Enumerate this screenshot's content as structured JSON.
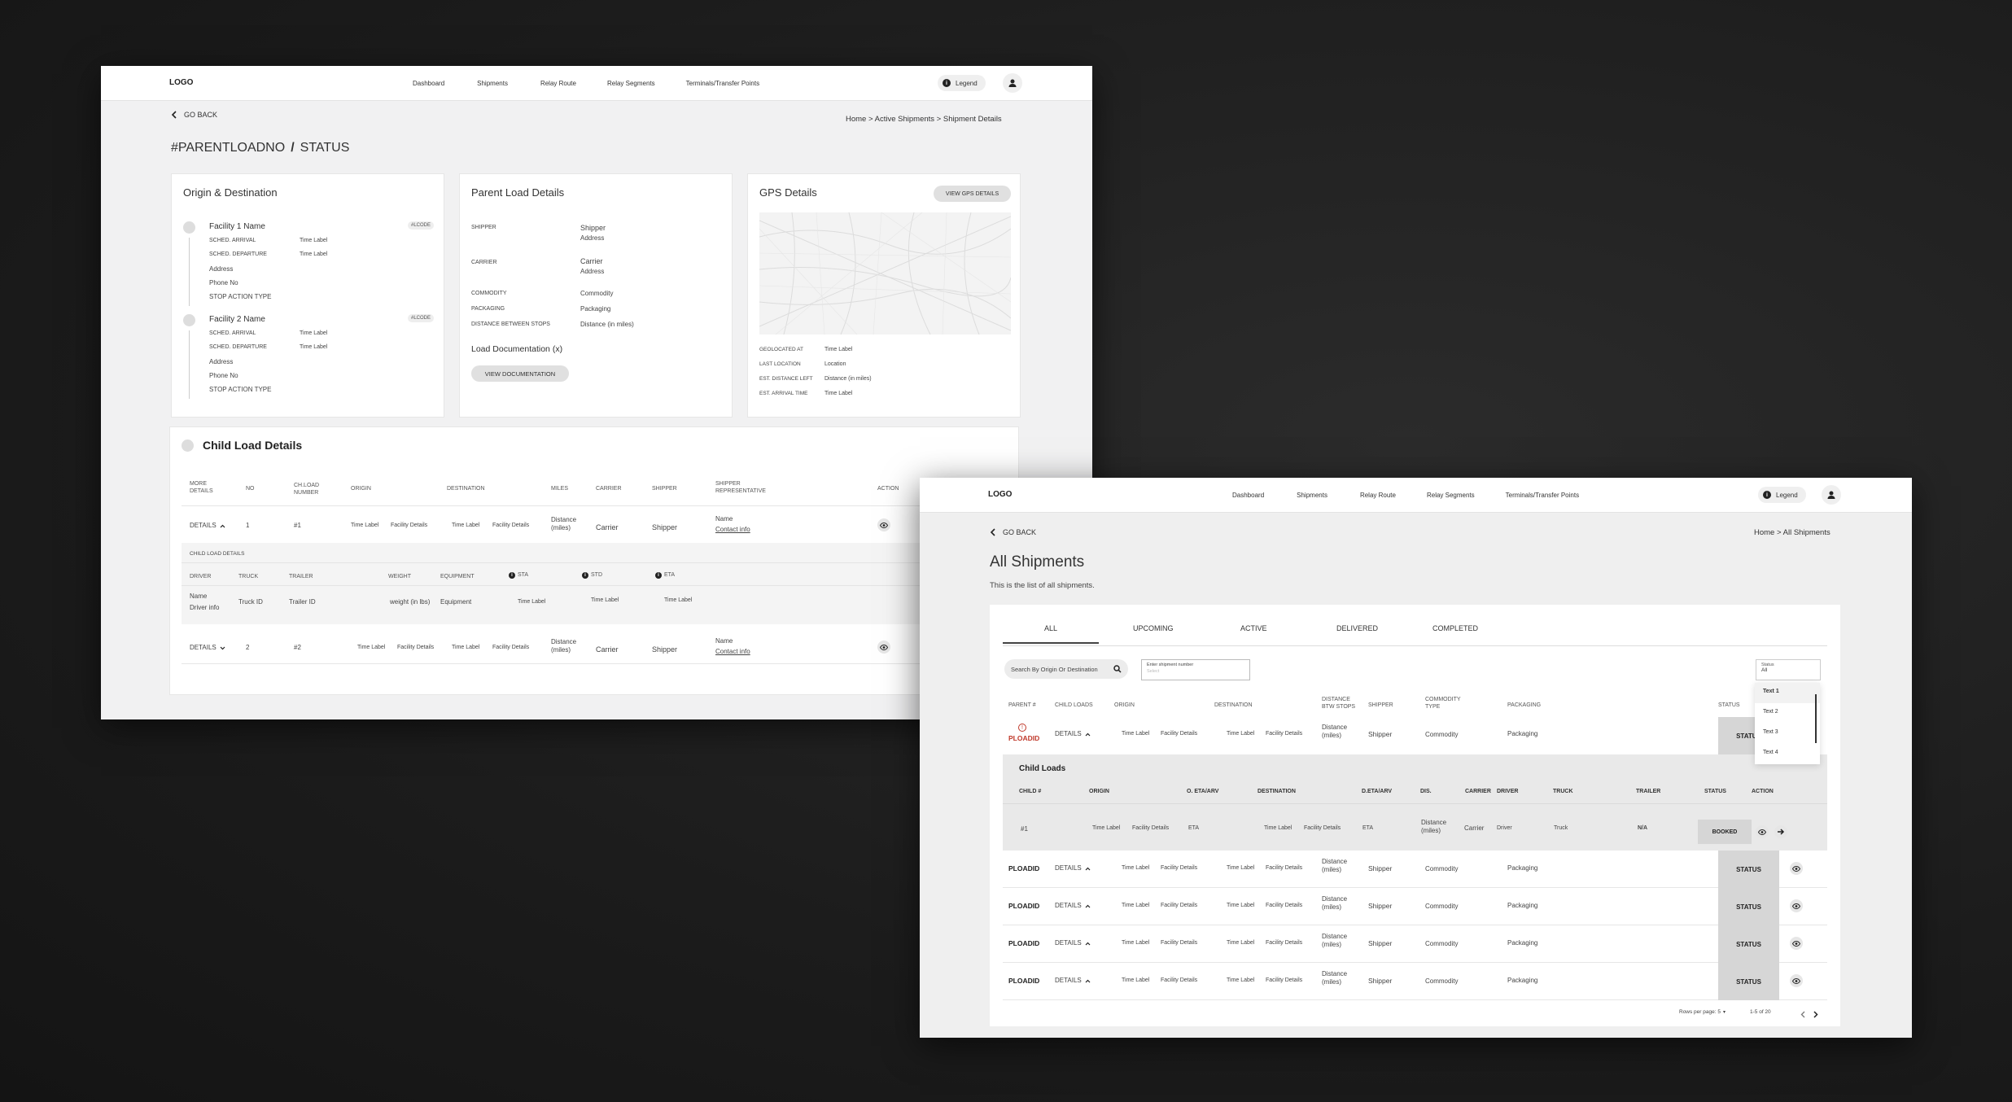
{
  "w1": {
    "logo": "LOGO",
    "nav": [
      "Dashboard",
      "Shipments",
      "Relay Route",
      "Relay Segments",
      "Terminals/Transfer Points"
    ],
    "legend": "Legend",
    "go_back": "GO BACK",
    "breadcrumb": "Home > Active Shipments > Shipment Details",
    "title_id": "#PARENTLOADNO",
    "title_sep": "/",
    "title_status": "STATUS",
    "origin": {
      "title": "Origin & Destination",
      "stops": [
        {
          "name": "Facility 1 Name",
          "code": "#LCODE",
          "arrival_label": "SCHED. ARRIVAL",
          "arrival": "Time Label",
          "departure_label": "SCHED. DEPARTURE",
          "departure": "Time Label",
          "address": "Address",
          "phone": "Phone No",
          "action": "STOP ACTION TYPE"
        },
        {
          "name": "Facility 2 Name",
          "code": "#LCODE",
          "arrival_label": "SCHED. ARRIVAL",
          "arrival": "Time Label",
          "departure_label": "SCHED. DEPARTURE",
          "departure": "Time Label",
          "address": "Address",
          "phone": "Phone No",
          "action": "STOP ACTION TYPE"
        }
      ]
    },
    "parent": {
      "title": "Parent Load Details",
      "shipper_label": "SHIPPER",
      "shipper": "Shipper",
      "shipper_addr": "Address",
      "carrier_label": "CARRIER",
      "carrier": "Carrier",
      "carrier_addr": "Address",
      "commodity_label": "COMMODITY",
      "commodity": "Commodity",
      "packaging_label": "PACKAGING",
      "packaging": "Packaging",
      "distance_label": "DISTANCE BETWEEN STOPS",
      "distance": "Distance (in miles)",
      "doc_title": "Load Documentation (x)",
      "doc_button": "VIEW DOCUMENTATION"
    },
    "gps": {
      "title": "GPS Details",
      "button": "VIEW GPS DETAILS",
      "rows": [
        [
          "GEOLOCATED AT",
          "Time Label"
        ],
        [
          "LAST LOCATION",
          "Location"
        ],
        [
          "EST. DISTANCE LEFT",
          "Distance (in miles)"
        ],
        [
          "EST. ARRIVAL TIME",
          "Time Label"
        ]
      ]
    },
    "child": {
      "title": "Child Load Details",
      "headers": [
        "MORE DETAILS",
        "NO",
        "CH.LOAD NUMBER",
        "ORIGIN",
        "DESTINATION",
        "MILES",
        "CARRIER",
        "SHIPPER",
        "SHIPPER REPRESENTATIVE",
        "ACTION"
      ],
      "rows": [
        {
          "details": "DETAILS",
          "no": "1",
          "num": "#1",
          "o_time": "Time Label",
          "o_fac": "Facility Details",
          "d_time": "Time Label",
          "d_fac": "Facility Details",
          "miles": "Distance (miles)",
          "carrier": "Carrier",
          "shipper": "Shipper",
          "rep": "Name",
          "rep_link": "Contact info"
        },
        {
          "details": "DETAILS",
          "no": "2",
          "num": "#2",
          "o_time": "Time Label",
          "o_fac": "Facility Details",
          "d_time": "Time Label",
          "d_fac": "Facility Details",
          "miles": "Distance (miles)",
          "carrier": "Carrier",
          "shipper": "Shipper",
          "rep": "Name",
          "rep_link": "Contact info"
        }
      ],
      "sub_title": "CHILD LOAD DETAILS",
      "sub_headers": [
        "DRIVER",
        "TRUCK",
        "TRAILER",
        "WEIGHT",
        "EQUIPMENT",
        "STA",
        "STD",
        "ETA"
      ],
      "sub_row": {
        "driver": "Name",
        "driver_info": "Driver info",
        "truck": "Truck ID",
        "trailer": "Trailer ID",
        "weight": "weight (in lbs)",
        "equipment": "Equipment",
        "sta": "Time Label",
        "std": "Time Label",
        "eta": "Time Label"
      }
    }
  },
  "w2": {
    "logo": "LOGO",
    "nav": [
      "Dashboard",
      "Shipments",
      "Relay Route",
      "Relay Segments",
      "Terminals/Transfer Points"
    ],
    "legend": "Legend",
    "go_back": "GO BACK",
    "breadcrumb": "Home > All Shipments",
    "title": "All Shipments",
    "subtitle": "This is the list of all shipments.",
    "tabs": [
      "ALL",
      "UPCOMING",
      "ACTIVE",
      "DELIVERED",
      "COMPLETED"
    ],
    "search_placeholder": "Search By Origin Or Destination",
    "shipment_label": "Enter shipment number",
    "shipment_placeholder": "Select",
    "status_select": {
      "label": "Status",
      "value": "All",
      "options": [
        "Text 1",
        "Text 2",
        "Text 3",
        "Text 4"
      ]
    },
    "headers": [
      "PARENT #",
      "CHILD LOADS",
      "ORIGIN",
      "DESTINATION",
      "DISTANCE BTW STOPS",
      "SHIPPER",
      "COMMODITY TYPE",
      "PACKAGING",
      "STATUS"
    ],
    "first_row": {
      "id": "PLOADID",
      "details": "DETAILS",
      "o_time": "Time Label",
      "o_fac": "Facility Details",
      "d_time": "Time Label",
      "d_fac": "Facility Details",
      "distance": "Distance (miles)",
      "shipper": "Shipper",
      "commodity": "Commodity",
      "packaging": "Packaging",
      "status": "STATUS"
    },
    "child": {
      "title": "Child Loads",
      "headers": [
        "CHILD #",
        "ORIGIN",
        "O. ETA/ARV",
        "DESTINATION",
        "D.ETA/ARV",
        "DIS.",
        "CARRIER",
        "DRIVER",
        "TRUCK",
        "TRAILER",
        "STATUS",
        "ACTION"
      ],
      "row": {
        "id": "#1",
        "o_time": "Time Label",
        "o_fac": "Facility Details",
        "o_eta": "ETA",
        "d_time": "Time Label",
        "d_fac": "Facility Details",
        "d_eta": "ETA",
        "dis": "Distance (miles)",
        "carrier": "Carrier",
        "driver": "Driver",
        "truck": "Truck",
        "trailer": "N/A",
        "status": "BOOKED"
      }
    },
    "rows": [
      {
        "id": "PLOADID",
        "details": "DETAILS",
        "o_time": "Time Label",
        "o_fac": "Facility Details",
        "d_time": "Time Label",
        "d_fac": "Facility Details",
        "distance": "Distance (miles)",
        "shipper": "Shipper",
        "commodity": "Commodity",
        "packaging": "Packaging",
        "status": "STATUS"
      },
      {
        "id": "PLOADID",
        "details": "DETAILS",
        "o_time": "Time Label",
        "o_fac": "Facility Details",
        "d_time": "Time Label",
        "d_fac": "Facility Details",
        "distance": "Distance (miles)",
        "shipper": "Shipper",
        "commodity": "Commodity",
        "packaging": "Packaging",
        "status": "STATUS"
      },
      {
        "id": "PLOADID",
        "details": "DETAILS",
        "o_time": "Time Label",
        "o_fac": "Facility Details",
        "d_time": "Time Label",
        "d_fac": "Facility Details",
        "distance": "Distance (miles)",
        "shipper": "Shipper",
        "commodity": "Commodity",
        "packaging": "Packaging",
        "status": "STATUS"
      },
      {
        "id": "PLOADID",
        "details": "DETAILS",
        "o_time": "Time Label",
        "o_fac": "Facility Details",
        "d_time": "Time Label",
        "d_fac": "Facility Details",
        "distance": "Distance (miles)",
        "shipper": "Shipper",
        "commodity": "Commodity",
        "packaging": "Packaging",
        "status": "STATUS"
      }
    ],
    "rows_per_page": "Rows per page: 5",
    "range": "1-5 of 20"
  },
  "colors": {
    "alert": "#c0392b",
    "status_bg": "#d6d6d6"
  }
}
